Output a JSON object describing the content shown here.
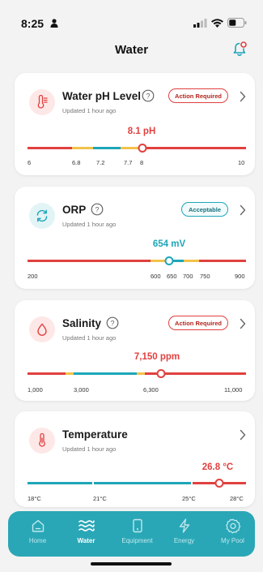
{
  "status_bar": {
    "time": "8:25"
  },
  "header": {
    "title": "Water"
  },
  "colors": {
    "red": "#e0413f",
    "yellow": "#f2c24a",
    "teal": "#1ea6b8",
    "tabbar": "#2aa7b6"
  },
  "cards": {
    "ph": {
      "title": "Water pH Level",
      "updated": "Updated 1 hour ago",
      "badge": "Action Required",
      "reading": "8.1 pH",
      "ticks": [
        "6",
        "6.8",
        "7.2",
        "7.7",
        "8",
        "10"
      ]
    },
    "orp": {
      "title": "ORP",
      "updated": "Updated 1 hour ago",
      "badge": "Acceptable",
      "reading": "654 mV",
      "ticks": [
        "200",
        "600",
        "650",
        "700",
        "750",
        "900"
      ]
    },
    "salinity": {
      "title": "Salinity",
      "updated": "Updated 1 hour ago",
      "badge": "Action Required",
      "reading": "7,150 ppm",
      "ticks": [
        "1,000",
        "3,000",
        "6,300",
        "11,000"
      ]
    },
    "temperature": {
      "title": "Temperature",
      "updated": "Updated 1 hour ago",
      "reading": "26.8 °C",
      "ticks": [
        "18°C",
        "21°C",
        "25°C",
        "28°C"
      ]
    }
  },
  "tabbar": {
    "items": [
      {
        "label": "Home",
        "icon": "home-icon",
        "active": false
      },
      {
        "label": "Water",
        "icon": "waves-icon",
        "active": true
      },
      {
        "label": "Equipment",
        "icon": "device-icon",
        "active": false
      },
      {
        "label": "Energy",
        "icon": "bolt-icon",
        "active": false
      },
      {
        "label": "My Pool",
        "icon": "gear-icon",
        "active": false
      }
    ]
  }
}
